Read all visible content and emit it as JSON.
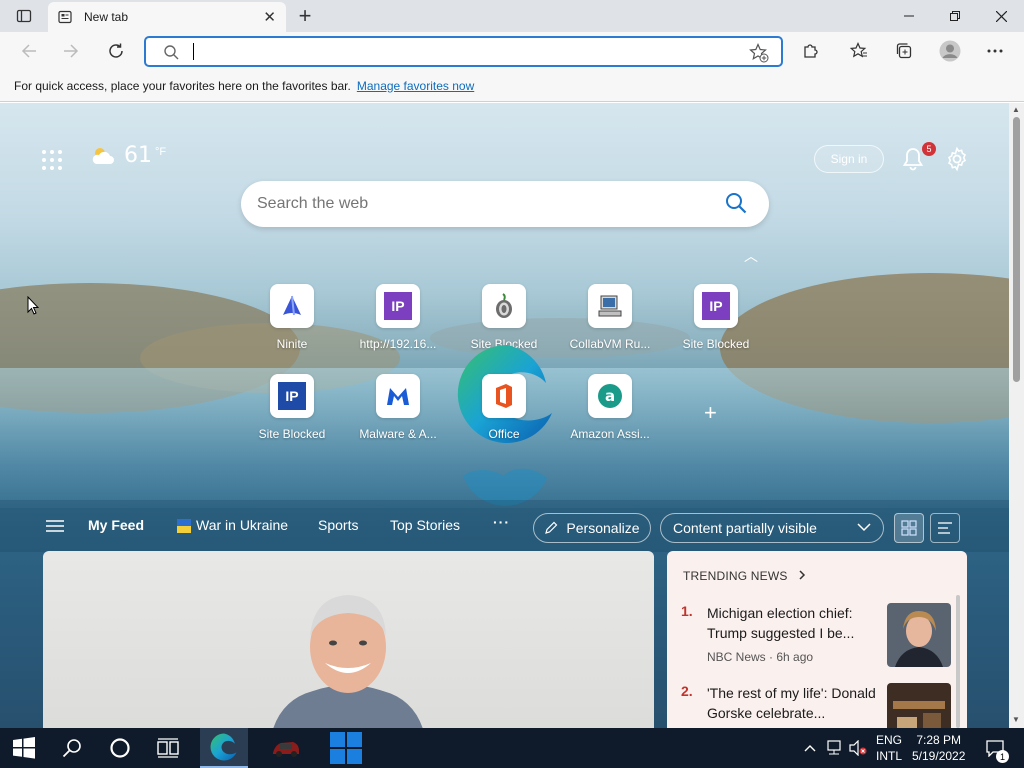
{
  "browser": {
    "tab_title": "New tab",
    "address_placeholder": "",
    "favorites_hint": "For quick access, place your favorites here on the favorites bar.",
    "favorites_link": "Manage favorites now"
  },
  "newtab": {
    "weather_temp": "61",
    "weather_unit": "°F",
    "signin_label": "Sign in",
    "notification_count": "5",
    "search_placeholder": "Search the web",
    "tiles": [
      {
        "label": "Ninite",
        "icon": "ninite-icon"
      },
      {
        "label": "http://192.16...",
        "icon": "ip-icon"
      },
      {
        "label": "Site Blocked",
        "icon": "tor-icon"
      },
      {
        "label": "CollabVM Ru...",
        "icon": "computer-icon"
      },
      {
        "label": "Site Blocked",
        "icon": "ip-icon"
      },
      {
        "label": "Site Blocked",
        "icon": "ip-icon"
      },
      {
        "label": "Malware & A...",
        "icon": "malwarebytes-icon"
      },
      {
        "label": "Office",
        "icon": "office-icon"
      },
      {
        "label": "Amazon Assi...",
        "icon": "amazon-icon"
      }
    ],
    "tile_ip_text": "IP"
  },
  "feed": {
    "nav": [
      "My Feed",
      "War in Ukraine",
      "Sports",
      "Top Stories"
    ],
    "more": "···",
    "personalize": "Personalize",
    "content_visibility": "Content partially visible",
    "trending_header": "TRENDING NEWS",
    "trending": [
      {
        "num": "1.",
        "headline": "Michigan election chief: Trump suggested I be...",
        "meta": "NBC News · 6h ago"
      },
      {
        "num": "2.",
        "headline": "'The rest of my life': Donald Gorske celebrate...",
        "meta": ""
      }
    ]
  },
  "taskbar": {
    "lang_line1": "ENG",
    "lang_line2": "INTL",
    "time": "7:28 PM",
    "date": "5/19/2022",
    "notif_count": "1"
  },
  "colors": {
    "accent": "#2b7bd3",
    "badge": "#d13438",
    "taskbar": "#0f1b2a"
  }
}
